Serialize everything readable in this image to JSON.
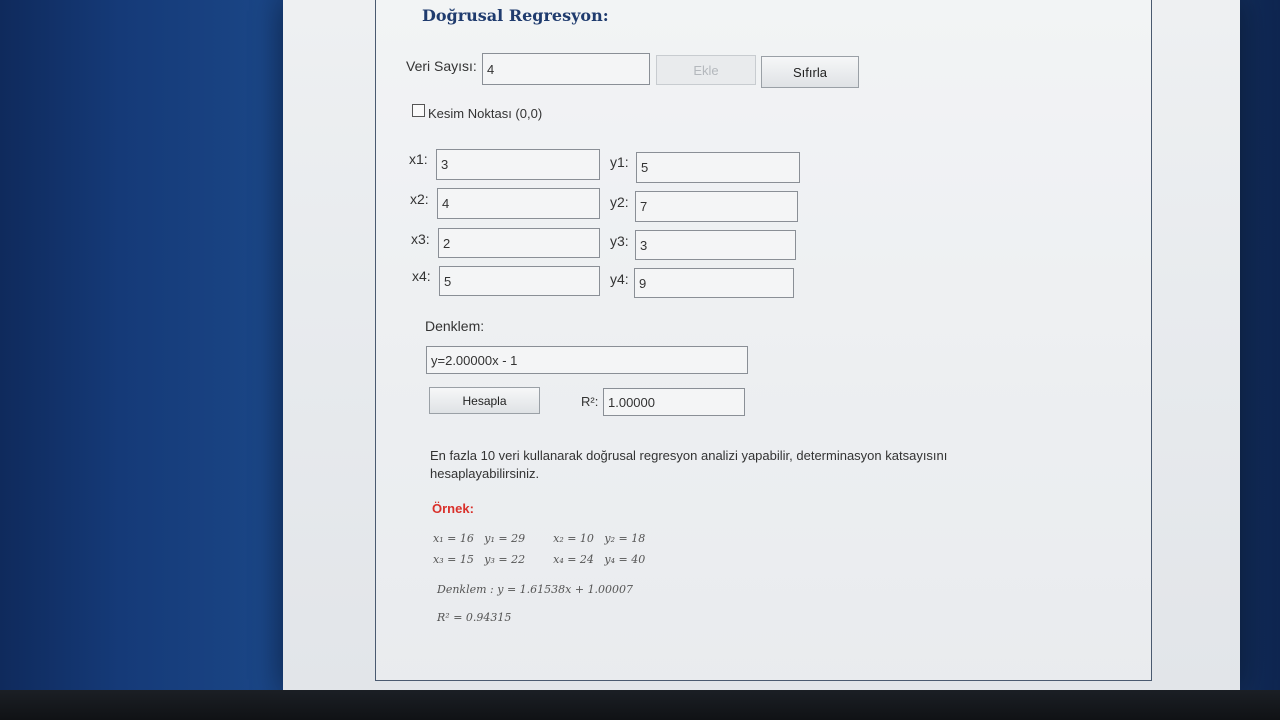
{
  "page": {
    "title": "Doğrusal Regresyon:",
    "veri_sayisi_label": "Veri Sayısı:",
    "veri_sayisi_value": "4",
    "ekle_label": "Ekle",
    "sifirla_label": "Sıfırla",
    "kesim_label": "Kesim Noktası (0,0)",
    "kesim_checked": false
  },
  "data_rows": [
    {
      "x_label": "x1:",
      "x_value": "3",
      "y_label": "y1:",
      "y_value": "5"
    },
    {
      "x_label": "x2:",
      "x_value": "4",
      "y_label": "y2:",
      "y_value": "7"
    },
    {
      "x_label": "x3:",
      "x_value": "2",
      "y_label": "y3:",
      "y_value": "3"
    },
    {
      "x_label": "x4:",
      "x_value": "5",
      "y_label": "y4:",
      "y_value": "9"
    }
  ],
  "result": {
    "denklem_label": "Denklem:",
    "denklem_value": "y=2.00000x - 1",
    "hesapla_label": "Hesapla",
    "r2_label": "R²:",
    "r2_value": "1.00000"
  },
  "info": {
    "description": "En fazla 10 veri kullanarak doğrusal regresyon analizi yapabilir, determinasyon katsayısını hesaplayabilirsiniz.",
    "example_title": "Örnek:",
    "example_line1": "x₁ = 16   y₁ = 29        x₂ = 10   y₂ = 18",
    "example_line2": "x₃ = 15   y₃ = 22        x₄ = 24   y₄ = 40",
    "example_equation": "Denklem : y = 1.61538x + 1.00007",
    "example_r2": "R² = 0.94315"
  },
  "colors": {
    "title": "#1f3b6e",
    "example_title": "#d9302a",
    "desktop": "#153a78"
  }
}
